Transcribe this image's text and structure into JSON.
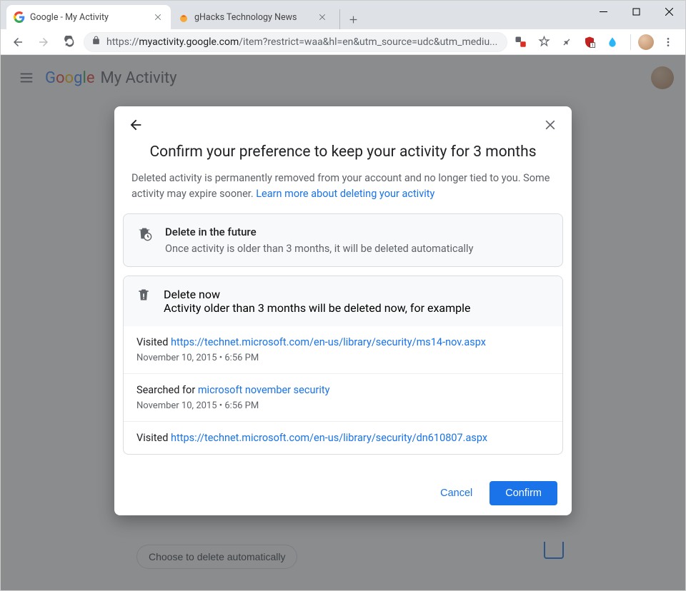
{
  "tabs": [
    {
      "title": "Google - My Activity"
    },
    {
      "title": "gHacks Technology News"
    }
  ],
  "url": {
    "proto": "https://",
    "domain": "myactivity.google.com",
    "path": "/item?restrict=waa&hl=en&utm_source=udc&utm_mediu..."
  },
  "app": {
    "myactivity": "My Activity"
  },
  "auto_delete_button": "Choose to delete automatically",
  "dialog": {
    "title": "Confirm your preference to keep your activity for 3 months",
    "desc_prefix": "Deleted activity is permanently removed from your account and no longer tied to you. Some activity may expire sooner. ",
    "desc_link": "Learn more about deleting your activity",
    "future": {
      "title": "Delete in the future",
      "sub": "Once activity is older than 3 months, it will be deleted automatically"
    },
    "now": {
      "title": "Delete now",
      "sub": "Activity older than 3 months will be deleted now, for example"
    },
    "items": [
      {
        "prefix": "Visited ",
        "link": "https://technet.microsoft.com/en-us/library/security/ms14-nov.aspx",
        "time": "November 10, 2015 • 6:56 PM"
      },
      {
        "prefix": "Searched for ",
        "link": "microsoft november security",
        "time": "November 10, 2015 • 6:56 PM"
      },
      {
        "prefix": "Visited ",
        "link": "https://technet.microsoft.com/en-us/library/security/dn610807.aspx",
        "time": ""
      }
    ],
    "cancel": "Cancel",
    "confirm": "Confirm"
  }
}
